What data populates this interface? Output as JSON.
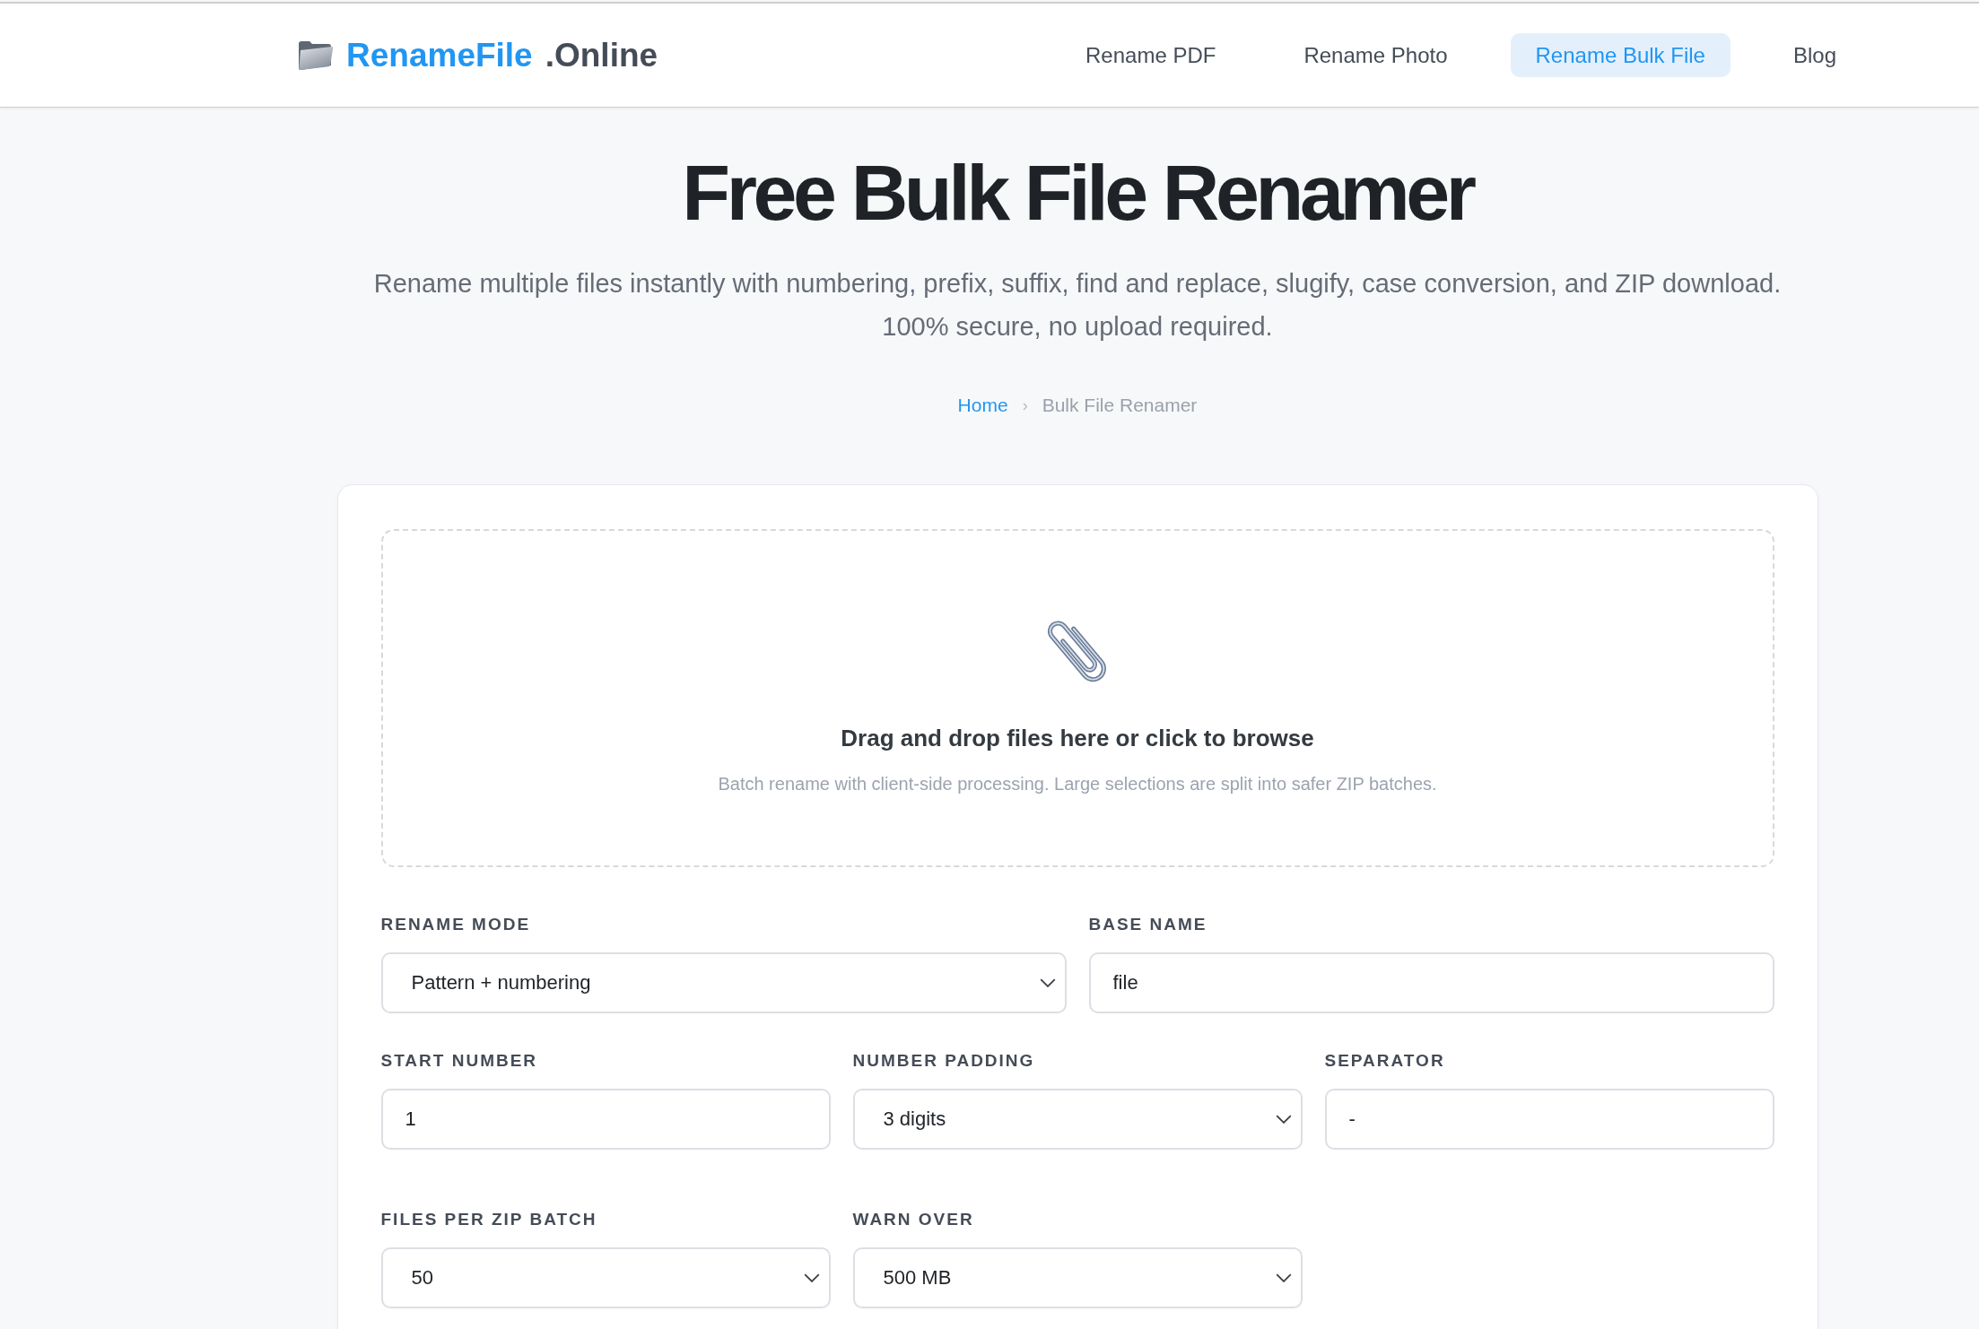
{
  "header": {
    "logo": {
      "name": "RenameFile",
      "suffix": ".Online"
    },
    "nav": [
      {
        "label": "Rename PDF",
        "selected": false
      },
      {
        "label": "Rename Photo",
        "selected": false
      },
      {
        "label": "Rename Bulk File",
        "selected": true
      },
      {
        "label": "Blog",
        "selected": false
      }
    ]
  },
  "hero": {
    "title": "Free Bulk File Renamer",
    "subtitle": "Rename multiple files instantly with numbering, prefix, suffix, find and replace, slugify, case conversion, and ZIP download. 100% secure, no upload required.",
    "breadcrumb": {
      "separator": "›",
      "items": [
        {
          "label": "Home",
          "kind": "link"
        },
        {
          "label": "Bulk File Renamer",
          "kind": "current"
        }
      ]
    }
  },
  "dropzone": {
    "title": "Drag and drop files here or click to browse",
    "hint": "Batch rename with client-side processing. Large selections are split into safer ZIP batches."
  },
  "form": {
    "rows": [
      [
        {
          "label": "RENAME MODE",
          "kind": "select",
          "value": "Pattern + numbering"
        },
        {
          "label": "BASE NAME",
          "kind": "text",
          "value": "file"
        }
      ],
      [
        {
          "label": "START NUMBER",
          "kind": "text",
          "value": "1"
        },
        {
          "label": "NUMBER PADDING",
          "kind": "select",
          "value": "3 digits"
        },
        {
          "label": "SEPARATOR",
          "kind": "text",
          "value": "-"
        }
      ],
      [
        {
          "label": "FILES PER ZIP BATCH",
          "kind": "select",
          "value": "50"
        },
        {
          "label": "WARN OVER",
          "kind": "select",
          "value": "500 MB"
        }
      ]
    ]
  }
}
